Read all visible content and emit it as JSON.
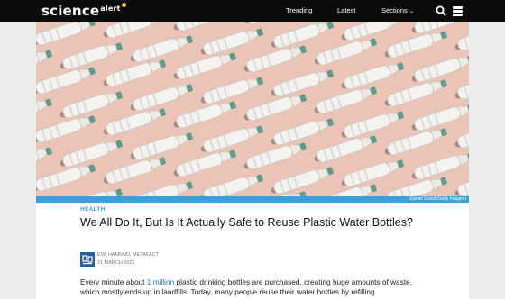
{
  "header": {
    "logo_main": "science",
    "logo_sub": "alert",
    "nav": [
      "Trending",
      "Latest",
      "Sections"
    ]
  },
  "hero": {
    "credit": "(Daniel Grizelj/Getty Images)"
  },
  "article": {
    "category": "HEALTH",
    "title": "We All Do It, But Is It Actually Safe to Reuse Plastic Water Bottles?",
    "author": "EVA HAMRUD, METAFACT",
    "date": "21 MARCH 2021",
    "para_start": "Every minute about ",
    "para_link": "1 million",
    "para_rest": " plastic drinking bottles are purchased, creating huge amounts of waste, which mostly ends up in landfills. Today, many people reuse their water bottles by refilling"
  },
  "colors": {
    "accent": "#3aa0dd",
    "topbar": "#0b0b0b",
    "hero_bg": "#ebc4b6"
  }
}
